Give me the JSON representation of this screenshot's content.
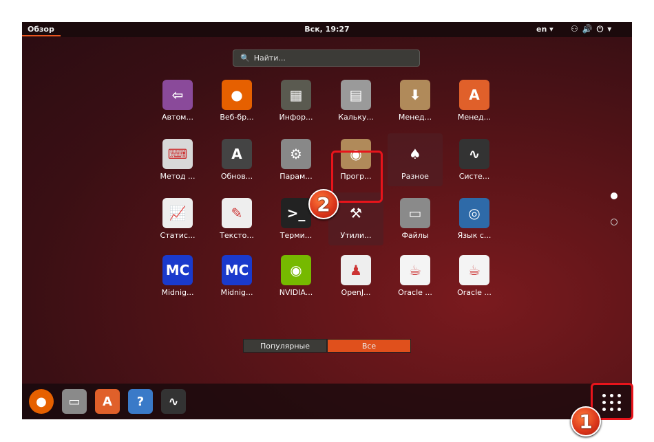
{
  "topbar": {
    "activities": "Обзор",
    "clock": "Вск, 19:27",
    "language": "en ▾",
    "tray_icons": [
      "network-icon",
      "volume-icon",
      "power-icon",
      "chevron-down-icon"
    ]
  },
  "search": {
    "placeholder": "Найти..."
  },
  "apps": [
    {
      "label": "Автом...",
      "icon": "startup-apps-icon",
      "color": "#8a4a9a",
      "glyph": "⇦"
    },
    {
      "label": "Веб-бр...",
      "icon": "firefox-icon",
      "color": "#e66000",
      "glyph": "●"
    },
    {
      "label": "Инфор...",
      "icon": "hardware-info-icon",
      "color": "#5a5a50",
      "glyph": "▦"
    },
    {
      "label": "Кальку...",
      "icon": "calculator-icon",
      "color": "#9a9a9a",
      "glyph": "▤"
    },
    {
      "label": "Менед...",
      "icon": "package-download-icon",
      "color": "#b08a5a",
      "glyph": "⬇"
    },
    {
      "label": "Менед...",
      "icon": "software-center-icon",
      "color": "#e0602a",
      "glyph": "A"
    },
    {
      "label": "Метод ...",
      "icon": "keyboard-icon",
      "color": "#d8d8d8",
      "glyph": "⌨"
    },
    {
      "label": "Обнов...",
      "icon": "software-updater-icon",
      "color": "#444",
      "glyph": "A"
    },
    {
      "label": "Парам...",
      "icon": "settings-icon",
      "color": "#888",
      "glyph": "⚙"
    },
    {
      "label": "Прогр...",
      "icon": "software-properties-icon",
      "color": "#b08a5a",
      "glyph": "◉"
    },
    {
      "label": "Разное",
      "icon": "folder-misc-icon",
      "color": "transparent",
      "glyph": "♠",
      "folder": true
    },
    {
      "label": "Систе...",
      "icon": "system-monitor-icon",
      "color": "#333",
      "glyph": "∿"
    },
    {
      "label": "Статис...",
      "icon": "statistics-icon",
      "color": "#eee",
      "glyph": "📈"
    },
    {
      "label": "Тексто...",
      "icon": "text-editor-icon",
      "color": "#eee",
      "glyph": "✎"
    },
    {
      "label": "Терми...",
      "icon": "terminal-icon",
      "color": "#222",
      "glyph": ">_"
    },
    {
      "label": "Утили...",
      "icon": "folder-utilities-icon",
      "color": "transparent",
      "glyph": "⚒",
      "folder": true
    },
    {
      "label": "Файлы",
      "icon": "files-icon",
      "color": "#8a8a8a",
      "glyph": "▭"
    },
    {
      "label": "Язык с...",
      "icon": "language-support-icon",
      "color": "#2e6aa8",
      "glyph": "◎"
    },
    {
      "label": "Midnig...",
      "icon": "midnight-commander-icon",
      "color": "#1a3acc",
      "glyph": "MC"
    },
    {
      "label": "Midnig...",
      "icon": "midnight-commander-icon",
      "color": "#1a3acc",
      "glyph": "MC"
    },
    {
      "label": "NVIDIA...",
      "icon": "nvidia-icon",
      "color": "#76b900",
      "glyph": "◉"
    },
    {
      "label": "OpenJ...",
      "icon": "openjdk-icon",
      "color": "#eee",
      "glyph": "♟"
    },
    {
      "label": "Oracle ...",
      "icon": "java-icon",
      "color": "#f4f4f4",
      "glyph": "☕"
    },
    {
      "label": "Oracle ...",
      "icon": "java-icon",
      "color": "#f4f4f4",
      "glyph": "☕"
    }
  ],
  "tabs": {
    "frequent": "Популярные",
    "all": "Все",
    "active": "all"
  },
  "pages": {
    "current": 1,
    "total": 2
  },
  "dock": [
    {
      "icon": "firefox-icon",
      "color": "#e66000",
      "glyph": "●"
    },
    {
      "icon": "files-icon",
      "color": "#8a8a8a",
      "glyph": "▭"
    },
    {
      "icon": "software-center-icon",
      "color": "#e0602a",
      "glyph": "A"
    },
    {
      "icon": "help-icon",
      "color": "#3a7ac8",
      "glyph": "?"
    },
    {
      "icon": "system-monitor-icon",
      "color": "#333",
      "glyph": "∿"
    }
  ],
  "annotations": {
    "step1": "1",
    "step2": "2"
  },
  "colors": {
    "accent": "#e95420",
    "highlight": "#e8141b"
  }
}
